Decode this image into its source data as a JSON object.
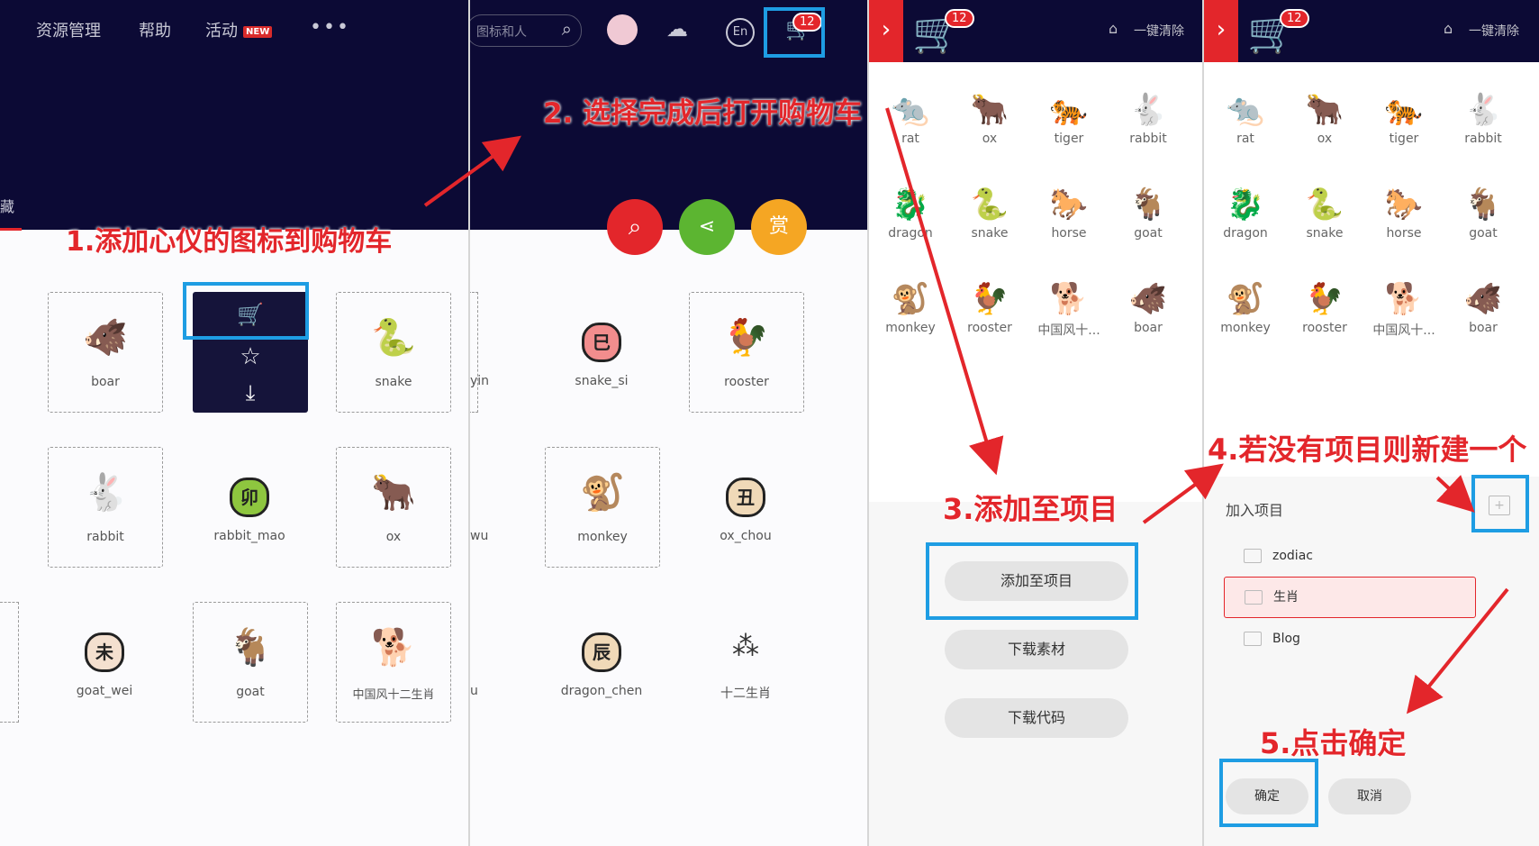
{
  "panel1": {
    "nav": [
      "资源管理",
      "帮助",
      "活动"
    ],
    "new_badge": "NEW",
    "more": "•••",
    "side_text": "藏",
    "annotation": "1.添加心仪的图标到购物车",
    "cards": [
      {
        "label": "boar",
        "icon": "🐗"
      },
      {
        "label": "snake",
        "icon": "🐍"
      },
      {
        "label": "rabbit",
        "icon": "🐇"
      },
      {
        "label": "rabbit_mao",
        "icon": "卯"
      },
      {
        "label": "ox",
        "icon": "🐂"
      },
      {
        "label": "goat_wei",
        "icon": "未"
      },
      {
        "label": "goat",
        "icon": "🐐"
      },
      {
        "label": "中国风十二生肖",
        "icon": "🐕"
      }
    ],
    "hover_icons": [
      "cart-icon",
      "star-icon",
      "download-icon"
    ]
  },
  "panel2": {
    "search_placeholder": "图标和人",
    "cart_count": "12",
    "lang": "En",
    "annotation": "2. 选择完成后打开购物车",
    "action_icons": [
      "search-icon",
      "share-icon",
      "reward-icon"
    ],
    "reward_glyph": "赏",
    "partial_labels": [
      "yin",
      "wu",
      "u"
    ],
    "cards": [
      {
        "label": "snake_si",
        "icon": "巳"
      },
      {
        "label": "rooster",
        "icon": "🐓"
      },
      {
        "label": "monkey",
        "icon": "🐒"
      },
      {
        "label": "ox_chou",
        "icon": "丑"
      },
      {
        "label": "dragon_chen",
        "icon": "辰"
      },
      {
        "label": "十二生肖",
        "icon": "⁂"
      }
    ]
  },
  "cart": {
    "badge": "12",
    "clear_label": "一键清除",
    "icons": [
      {
        "label": "rat",
        "icon": "🐀"
      },
      {
        "label": "ox",
        "icon": "🐂"
      },
      {
        "label": "tiger",
        "icon": "🐅"
      },
      {
        "label": "rabbit",
        "icon": "🐇"
      },
      {
        "label": "dragon",
        "icon": "🐉"
      },
      {
        "label": "snake",
        "icon": "🐍"
      },
      {
        "label": "horse",
        "icon": "🐎"
      },
      {
        "label": "goat",
        "icon": "🐐"
      },
      {
        "label": "monkey",
        "icon": "🐒"
      },
      {
        "label": "rooster",
        "icon": "🐓"
      },
      {
        "label": "中国风十...",
        "icon": "🐕"
      },
      {
        "label": "boar",
        "icon": "🐗"
      }
    ]
  },
  "panel3": {
    "annotation": "3.添加至项目",
    "buttons": [
      "添加至项目",
      "下载素材",
      "下载代码"
    ]
  },
  "panel4": {
    "annotation_new": "4.若没有项目则新建一个",
    "annotation_ok": "5.点击确定",
    "add_to_project": "加入项目",
    "projects": [
      "zodiac",
      "生肖",
      "Blog"
    ],
    "confirm": "确定",
    "cancel": "取消"
  },
  "colors": {
    "dark_header": "#0c0a35",
    "accent_red": "#e3262b",
    "highlight_blue": "#1e9de3",
    "share_green": "#5cb531",
    "reward_orange": "#f5a623"
  }
}
